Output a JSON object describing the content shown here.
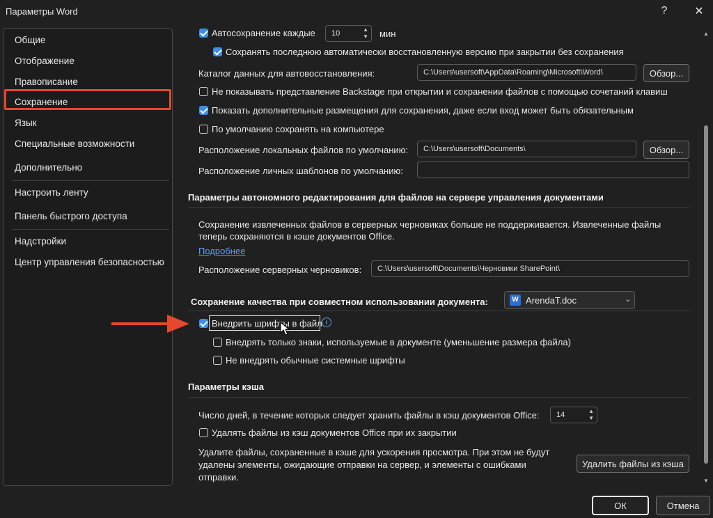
{
  "window": {
    "title": "Параметры Word",
    "help_icon": "?",
    "close_icon": "✕"
  },
  "sidebar": {
    "items": [
      {
        "label": "Общие"
      },
      {
        "label": "Отображение"
      },
      {
        "label": "Правописание"
      },
      {
        "label": "Сохранение"
      },
      {
        "label": "Язык"
      },
      {
        "label": "Специальные возможности"
      },
      {
        "label": "Дополнительно"
      },
      {
        "label": "Настроить ленту"
      },
      {
        "label": "Панель быстрого доступа"
      },
      {
        "label": "Надстройки"
      },
      {
        "label": "Центр управления безопасностью"
      }
    ],
    "active": "Сохранение"
  },
  "save": {
    "autosave_label": "Автосохранение каждые",
    "autosave_value": "10",
    "autosave_unit": "мин",
    "keep_last_label": "Сохранять последнюю автоматически восстановленную версию при закрытии без сохранения",
    "autorecover_label": "Каталог данных для автовосстановления:",
    "autorecover_path": "C:\\Users\\usersoft\\AppData\\Roaming\\Microsoft\\Word\\",
    "browse_label": "Обзор...",
    "no_backstage_label": "Не показывать представление Backstage при открытии и сохранении файлов с помощью сочетаний клавиш",
    "show_locations_label": "Показать дополнительные размещения для сохранения, даже если вход может быть обязательным",
    "save_to_computer_label": "По умолчанию сохранять на компьютере",
    "local_location_label": "Расположение локальных файлов по умолчанию:",
    "local_location_path": "C:\\Users\\usersoft\\Documents\\",
    "templates_label": "Расположение личных шаблонов по умолчанию:",
    "templates_path": ""
  },
  "offline": {
    "header": "Параметры автономного редактирования для файлов на сервере управления документами",
    "info_line1": "Сохранение извлеченных файлов в серверных черновиках больше не поддерживается. Извлеченные файлы",
    "info_line2": "теперь сохраняются в кэше документов Office.",
    "more_link": "Подробнее",
    "drafts_label": "Расположение серверных черновиков:",
    "drafts_path": "C:\\Users\\usersoft\\Documents\\Черновики SharePoint\\"
  },
  "fidelity": {
    "header": "Сохранение качества при совместном использовании документа:",
    "document": "ArendaT.doc",
    "embed_fonts_label": "Внедрить шрифты в файл",
    "embed_used_label": "Внедрять только знаки, используемые в документе (уменьшение размера файла)",
    "no_system_label": "Не внедрять обычные системные шрифты"
  },
  "cache": {
    "header": "Параметры кэша",
    "days_label": "Число дней, в течение которых следует хранить файлы в кэш документов Office:",
    "days_value": "14",
    "delete_on_close_label": "Удалять файлы из кэш документов Office при их закрытии",
    "delete_info_line1": "Удалите файлы, сохраненные в кэше для ускорения просмотра. При этом не будут",
    "delete_info_line2": "удалены элементы, ожидающие отправки на сервер, и элементы с ошибками",
    "delete_info_line3": "отправки.",
    "delete_button": "Удалить файлы из кэша"
  },
  "footer": {
    "ok": "ОК",
    "cancel": "Отмена"
  },
  "colors": {
    "accent": "#3d8ee6",
    "highlight": "#e5482c"
  }
}
